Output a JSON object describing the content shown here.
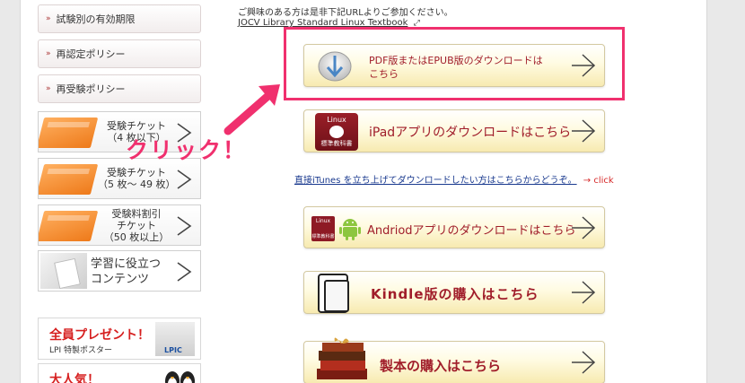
{
  "sidebar": {
    "nav_items": [
      "試験別の有効期限",
      "再認定ポリシー",
      "再受験ポリシー"
    ],
    "nav_bullet": "»",
    "tickets": [
      {
        "line1": "受験チケット",
        "line2": "（4 枚以下）"
      },
      {
        "line1": "受験チケット",
        "line2": "（5 枚～ 49 枚）"
      },
      {
        "line1": "受験料割引",
        "line2": "チケット",
        "line3": "（50 枚以上）"
      }
    ],
    "study": {
      "line1": "学習に役立つ",
      "line2": "コンテンツ"
    },
    "promo": {
      "headline": "全員プレゼント！",
      "subtext": "LPI 特製ポスター",
      "logo": "LPIC"
    },
    "promo2": {
      "headline": "大人気！"
    }
  },
  "main": {
    "intro_text": "ご興味のある方は是非下記URLよりご参加ください。",
    "intro_link": "JOCV Library Standard Linux Textbook",
    "download_buttons": [
      {
        "label_line1": "PDF版またはEPUB版のダウンロードは",
        "label_line2": "こちら",
        "icon": "download-arrow-icon"
      },
      {
        "label": "iPadアプリのダウンロードはこちら",
        "icon": "linux-textbook-icon",
        "icon_text_top": "Linux",
        "icon_text_bottom": "標準教科書"
      },
      {
        "label": "Andriodアプリのダウンロードはこちら",
        "icon": "android-icon",
        "icon_text_top": "Linux",
        "icon_text_bottom": "標準教科書"
      },
      {
        "label": "Kindle版の購入はこちら",
        "icon": "kindle-icon"
      },
      {
        "label": "製本の購入はこちら",
        "icon": "books-gift-icon"
      }
    ],
    "itunes_link": "直接iTunes を立ち上げてダウンロードしたい方はこちらからどうぞ。",
    "itunes_click": "→ click",
    "annotation": "クリック！"
  },
  "colors": {
    "highlight": "#f0306e",
    "button_text": "#a01d2a",
    "link": "#1a3a8f",
    "accent_red": "#d62a2a"
  }
}
